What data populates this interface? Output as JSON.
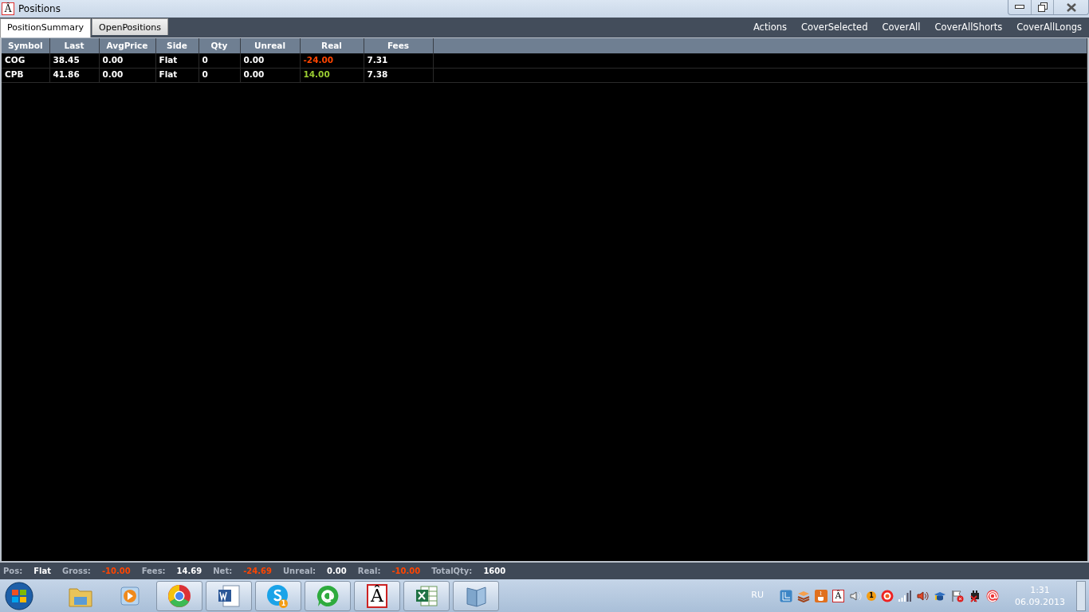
{
  "window": {
    "icon_glyph": "Â",
    "title": "Positions"
  },
  "tabs": [
    {
      "label": "PositionSummary",
      "selected": true
    },
    {
      "label": "OpenPositions",
      "selected": false
    }
  ],
  "actions": {
    "label": "Actions",
    "buttons": [
      "CoverSelected",
      "CoverAll",
      "CoverAllShorts",
      "CoverAllLongs"
    ]
  },
  "table": {
    "columns": [
      "Symbol",
      "Last",
      "AvgPrice",
      "Side",
      "Qty",
      "Unreal",
      "Real",
      "Fees"
    ],
    "rows": [
      {
        "cells": [
          {
            "text": "COG"
          },
          {
            "text": "38.45"
          },
          {
            "text": "0.00"
          },
          {
            "text": "Flat"
          },
          {
            "text": "0"
          },
          {
            "text": "0.00"
          },
          {
            "text": "-24.00",
            "color": "#ff4500"
          },
          {
            "text": "7.31"
          }
        ]
      },
      {
        "cells": [
          {
            "text": "CPB"
          },
          {
            "text": "41.86"
          },
          {
            "text": "0.00"
          },
          {
            "text": "Flat"
          },
          {
            "text": "0"
          },
          {
            "text": "0.00"
          },
          {
            "text": "14.00",
            "color": "#9acd32"
          },
          {
            "text": "7.38"
          }
        ]
      }
    ]
  },
  "status_bar": [
    {
      "label": "Pos:",
      "value": "Flat",
      "color": "#ffffff"
    },
    {
      "label": "Gross:",
      "value": "-10.00",
      "color": "#ff4500"
    },
    {
      "label": "Fees:",
      "value": "14.69",
      "color": "#ffffff"
    },
    {
      "label": "Net:",
      "value": "-24.69",
      "color": "#ff4500"
    },
    {
      "label": "Unreal:",
      "value": "0.00",
      "color": "#ffffff"
    },
    {
      "label": "Real:",
      "value": "-10.00",
      "color": "#ff4500"
    },
    {
      "label": "TotalQty:",
      "value": "1600",
      "color": "#ffffff"
    }
  ],
  "taskbar": {
    "buttons": [
      {
        "running": false
      },
      {
        "running": false
      },
      {
        "running": true
      },
      {
        "running": true
      },
      {
        "running": true,
        "badge": "1"
      },
      {
        "running": true
      },
      {
        "running": true,
        "glyph": "Â"
      },
      {
        "running": true
      },
      {
        "running": true
      }
    ]
  },
  "tray": {
    "language": "RU",
    "glyph": "Â",
    "badge": "1",
    "time": "1:31",
    "date": "06.09.2013"
  }
}
